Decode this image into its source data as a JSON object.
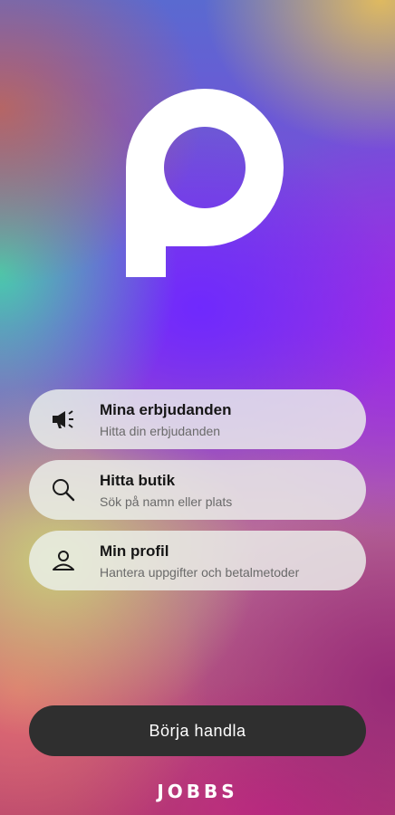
{
  "logo": {
    "name": "p-logo"
  },
  "menu": {
    "items": [
      {
        "title": "Mina erbjudanden",
        "subtitle": "Hitta din erbjudanden",
        "icon": "megaphone-icon"
      },
      {
        "title": "Hitta butik",
        "subtitle": "Sök på namn eller plats",
        "icon": "search-icon"
      },
      {
        "title": "Min profil",
        "subtitle": "Hantera uppgifter och betalmetoder",
        "icon": "person-icon"
      }
    ]
  },
  "cta": {
    "label": "Börja handla"
  },
  "brand": {
    "text": "JOBBS"
  },
  "colors": {
    "button": "#2f2f2f",
    "card": "#ebf0ec",
    "logo": "#ffffff"
  }
}
